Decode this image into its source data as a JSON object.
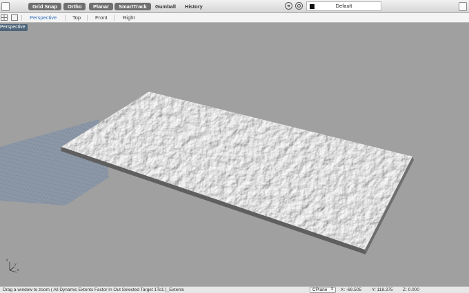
{
  "toolbar": {
    "grid_snap": "Grid Snap",
    "ortho": "Ortho",
    "planar": "Planar",
    "smarttrack": "SmartTrack",
    "gumball": "Gumball",
    "history": "History",
    "layer": "Default",
    "layer_color": "#111111"
  },
  "tabs": {
    "perspective": "Perspective",
    "top": "Top",
    "front": "Front",
    "right": "Right"
  },
  "viewport": {
    "label": "Perspective",
    "axis_x": "x",
    "axis_y": "y",
    "axis_z": "z"
  },
  "status": {
    "message": "Drag a window to zoom ( All Dynamic Extents Factor In Out Selected Target 1To1 )_Extents",
    "cplane": "CPlane",
    "x": "X: -69.505",
    "y": "Y: 118.375",
    "z": "Z: 0.000"
  },
  "colors": {
    "active_tab": "#2f6fbf",
    "pill_bg": "#6f6f6f",
    "viewport_bg": "#a0a0a0",
    "grid_fill": "#8c97a7"
  }
}
